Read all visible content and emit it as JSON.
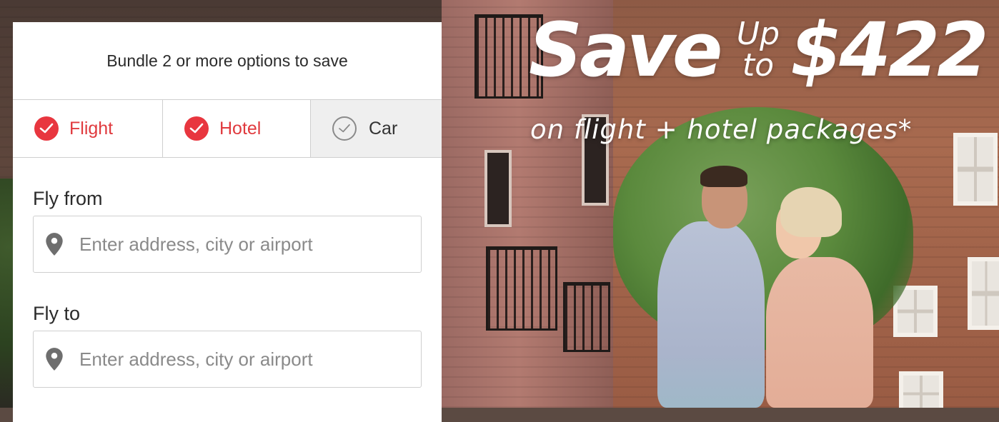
{
  "booking": {
    "title": "Bundle 2 or more options to save",
    "tabs": [
      {
        "label": "Flight",
        "selected": true
      },
      {
        "label": "Hotel",
        "selected": true
      },
      {
        "label": "Car",
        "selected": false
      }
    ],
    "fly_from": {
      "label": "Fly from",
      "placeholder": "Enter address, city or airport",
      "icon": "location-pin-icon"
    },
    "fly_to": {
      "label": "Fly to",
      "placeholder": "Enter address, city or airport",
      "icon": "location-pin-icon"
    }
  },
  "promo": {
    "save_word": "Save",
    "up": "Up",
    "to": "to",
    "amount": "$422",
    "subline": "on flight + hotel packages*"
  },
  "colors": {
    "accent_red": "#e03a3e",
    "check_red": "#e8363f",
    "unselected_tab_bg": "#efefef",
    "border_gray": "#cfcfcf",
    "placeholder_gray": "#8a8a8a"
  }
}
